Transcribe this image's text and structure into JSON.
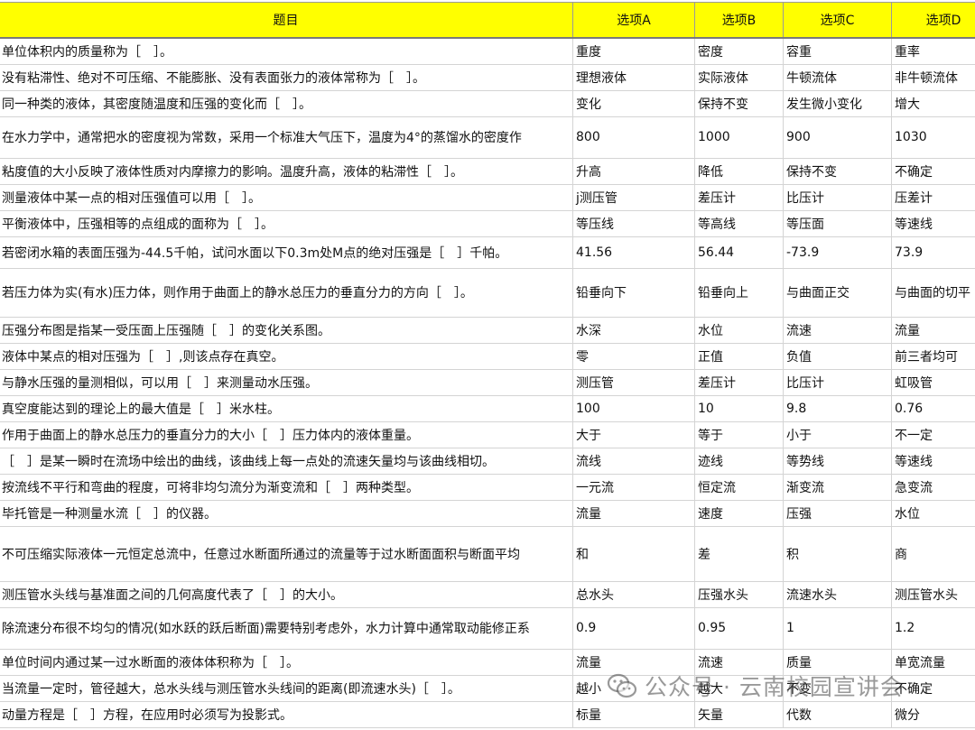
{
  "headers": [
    "题目",
    "选项A",
    "选项B",
    "选项C",
    "选项D"
  ],
  "rows": [
    [
      "单位体积内的质量称为［　］。",
      "重度",
      "密度",
      "容重",
      "重率"
    ],
    [
      "没有粘滞性、绝对不可压缩、不能膨胀、没有表面张力的液体常称为［　］。",
      "理想液体",
      "实际液体",
      "牛顿流体",
      "非牛顿流体"
    ],
    [
      "同一种类的液体，其密度随温度和压强的变化而［　］。",
      "变化",
      "保持不变",
      "发生微小变化",
      "增大"
    ],
    [
      "在水力学中，通常把水的密度视为常数，采用一个标准大气压下，温度为4°的蒸馏水的密度作",
      "800",
      "1000",
      "900",
      "1030"
    ],
    [
      "粘度值的大小反映了液体性质对内摩擦力的影响。温度升高，液体的粘滞性［　］。",
      "升高",
      "降低",
      "保持不变",
      "不确定"
    ],
    [
      "测量液体中某一点的相对压强值可以用［　］。",
      "j测压管",
      "差压计",
      "比压计",
      "压差计"
    ],
    [
      "平衡液体中，压强相等的点组成的面称为［　］。",
      "等压线",
      "等高线",
      "等压面",
      "等速线"
    ],
    [
      "若密闭水箱的表面压强为-44.5千帕，试问水面以下0.3m处M点的绝对压强是［　］千帕。",
      "41.56",
      "56.44",
      "-73.9",
      "73.9"
    ],
    [
      "若压力体为实(有水)压力体，则作用于曲面上的静水总压力的垂直分力的方向［　］。",
      "铅垂向下",
      "铅垂向上",
      "与曲面正交",
      "与曲面的切平"
    ],
    [
      "压强分布图是指某一受压面上压强随［　］的变化关系图。",
      "水深",
      "水位",
      "流速",
      "流量"
    ],
    [
      "液体中某点的相对压强为［　］,则该点存在真空。",
      "零",
      "正值",
      "负值",
      "前三者均可"
    ],
    [
      "与静水压强的量测相似，可以用［　］来测量动水压强。",
      "测压管",
      "差压计",
      "比压计",
      "虹吸管"
    ],
    [
      "真空度能达到的理论上的最大值是［　］米水柱。",
      "100",
      "10",
      "9.8",
      "0.76"
    ],
    [
      "作用于曲面上的静水总压力的垂直分力的大小［　］压力体内的液体重量。",
      "大于",
      "等于",
      "小于",
      "不一定"
    ],
    [
      "［　］是某一瞬时在流场中绘出的曲线，该曲线上每一点处的流速矢量均与该曲线相切。",
      "流线",
      "迹线",
      "等势线",
      "等速线"
    ],
    [
      "按流线不平行和弯曲的程度，可将非均匀流分为渐变流和［　］两种类型。",
      "一元流",
      "恒定流",
      "渐变流",
      "急变流"
    ],
    [
      "毕托管是一种测量水流［　］的仪器。",
      "流量",
      "速度",
      "压强",
      "水位"
    ],
    [
      "不可压缩实际液体一元恒定总流中，任意过水断面所通过的流量等于过水断面面积与断面平均",
      "和",
      "差",
      "积",
      "商"
    ],
    [
      "测压管水头线与基准面之间的几何高度代表了［　］的大小。",
      "总水头",
      "压强水头",
      "流速水头",
      "测压管水头"
    ],
    [
      "除流速分布很不均匀的情况(如水跃的跃后断面)需要特别考虑外，水力计算中通常取动能修正系",
      "0.9",
      "0.95",
      "1",
      "1.2"
    ],
    [
      "单位时间内通过某一过水断面的液体体积称为［　］。",
      "流量",
      "流速",
      "质量",
      "单宽流量"
    ],
    [
      "当流量一定时，管径越大，总水头线与测压管水头线间的距离(即流速水头)［　］。",
      "越小",
      "越大",
      "不变",
      "不确定"
    ],
    [
      "动量方程是［　］方程，在应用时必须写为投影式。",
      "标量",
      "矢量",
      "代数",
      "微分"
    ]
  ],
  "watermark": "公众号 · 云南校园宣讲会"
}
